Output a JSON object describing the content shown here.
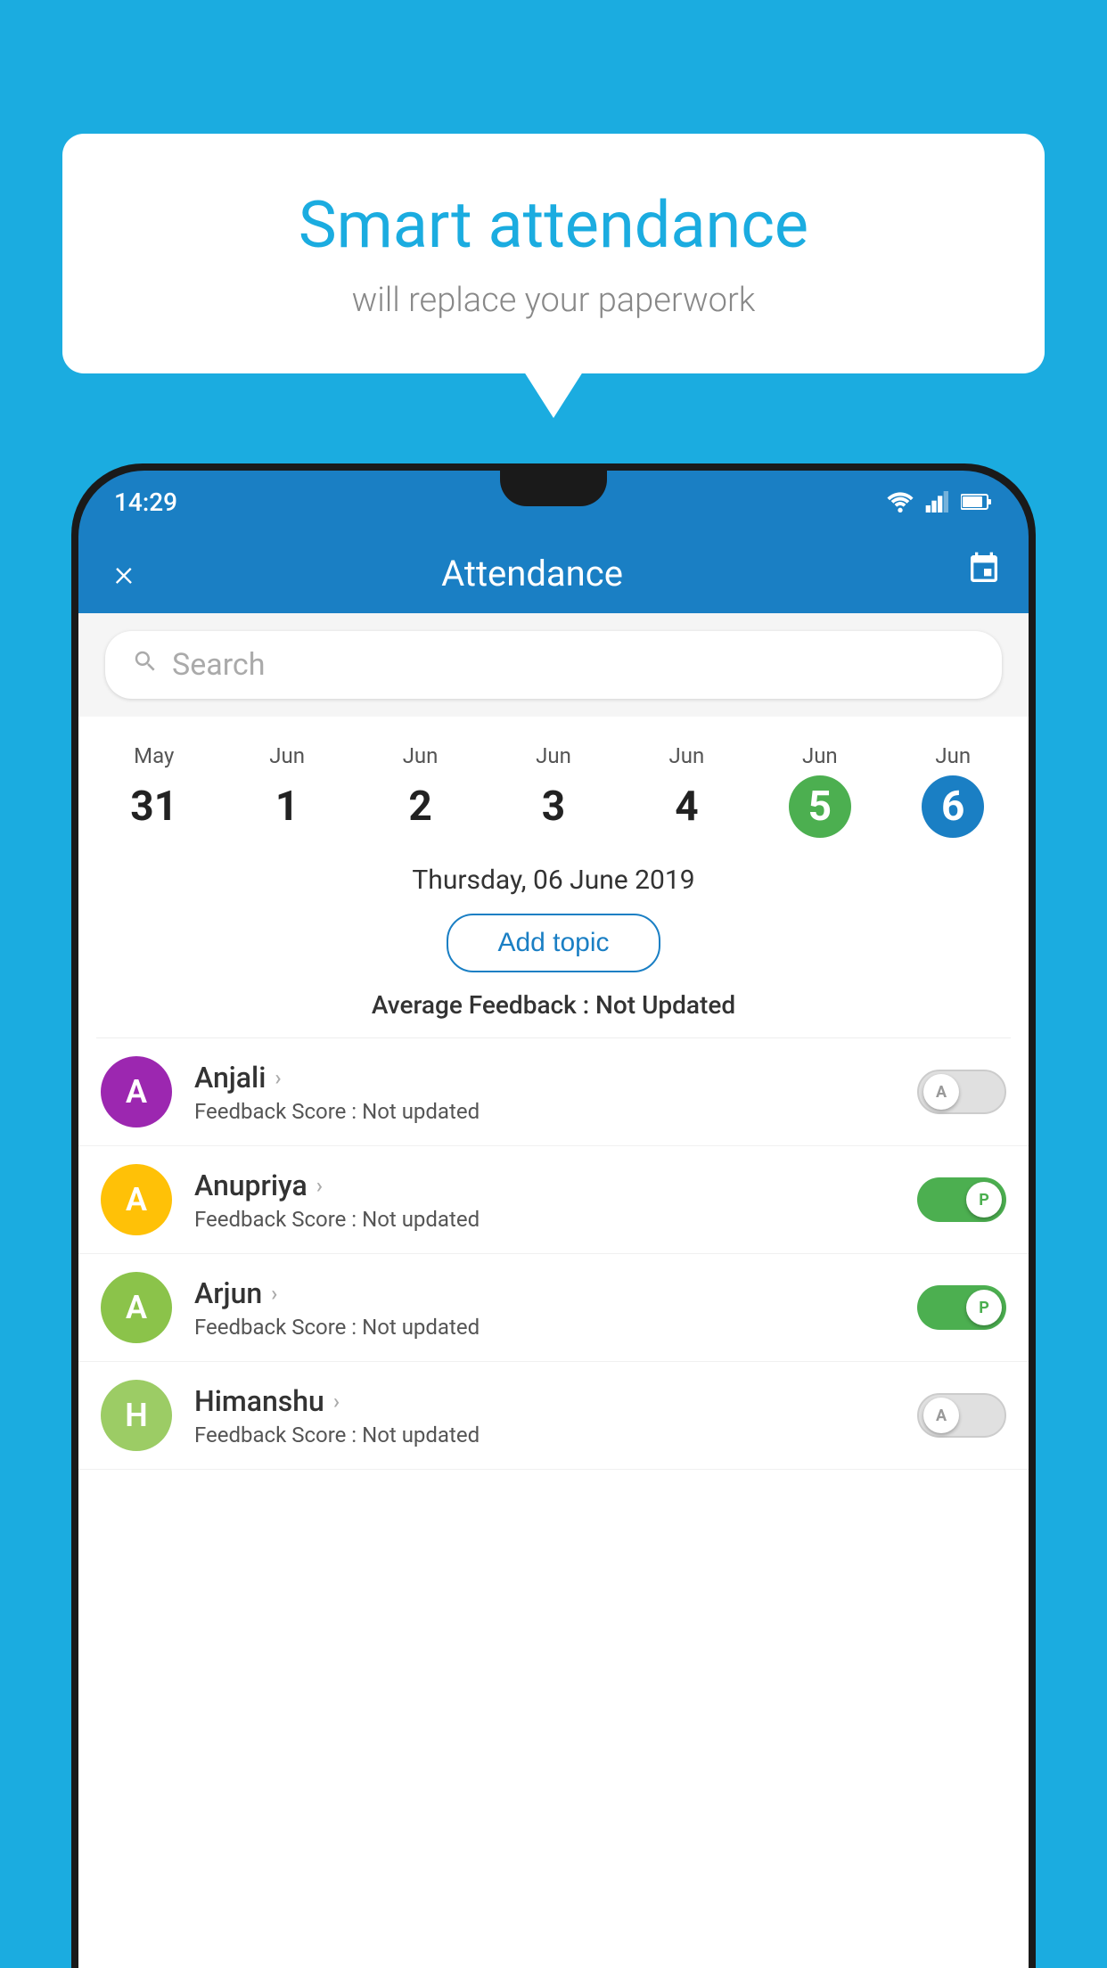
{
  "background_color": "#1BACE0",
  "speech_bubble": {
    "title": "Smart attendance",
    "subtitle": "will replace your paperwork"
  },
  "status_bar": {
    "time": "14:29"
  },
  "app_bar": {
    "title": "Attendance",
    "close_label": "×",
    "calendar_icon": "📅"
  },
  "search": {
    "placeholder": "Search"
  },
  "dates": [
    {
      "month": "May",
      "day": "31",
      "style": "normal"
    },
    {
      "month": "Jun",
      "day": "1",
      "style": "normal"
    },
    {
      "month": "Jun",
      "day": "2",
      "style": "normal"
    },
    {
      "month": "Jun",
      "day": "3",
      "style": "normal"
    },
    {
      "month": "Jun",
      "day": "4",
      "style": "normal"
    },
    {
      "month": "Jun",
      "day": "5",
      "style": "green"
    },
    {
      "month": "Jun",
      "day": "6",
      "style": "blue"
    }
  ],
  "selected_date": "Thursday, 06 June 2019",
  "add_topic_label": "Add topic",
  "avg_feedback_label": "Average Feedback :",
  "avg_feedback_value": "Not Updated",
  "students": [
    {
      "name": "Anjali",
      "initial": "A",
      "avatar_color": "purple",
      "feedback_label": "Feedback Score :",
      "feedback_value": "Not updated",
      "toggle_state": "off",
      "toggle_label": "A"
    },
    {
      "name": "Anupriya",
      "initial": "A",
      "avatar_color": "yellow",
      "feedback_label": "Feedback Score :",
      "feedback_value": "Not updated",
      "toggle_state": "on",
      "toggle_label": "P"
    },
    {
      "name": "Arjun",
      "initial": "A",
      "avatar_color": "lightgreen",
      "feedback_label": "Feedback Score :",
      "feedback_value": "Not updated",
      "toggle_state": "on",
      "toggle_label": "P"
    },
    {
      "name": "Himanshu",
      "initial": "H",
      "avatar_color": "olive",
      "feedback_label": "Feedback Score :",
      "feedback_value": "Not updated",
      "toggle_state": "off",
      "toggle_label": "A"
    }
  ]
}
